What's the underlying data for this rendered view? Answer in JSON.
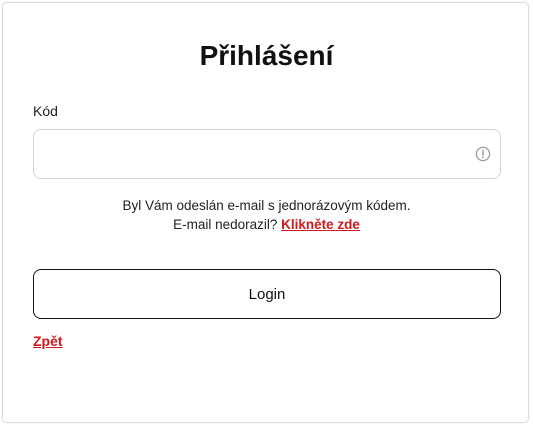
{
  "page": {
    "title": "Přihlášení"
  },
  "form": {
    "code_label": "Kód",
    "code_value": "",
    "code_placeholder": "",
    "info_line1": "Byl Vám odeslán e-mail s jednorázovým kódem.",
    "info_line2_prefix": "E-mail nedorazil?",
    "resend_link": "Klikněte zde",
    "login_button": "Login",
    "back_link": "Zpět"
  },
  "icons": {
    "field_status": "alert-circle-icon"
  },
  "colors": {
    "accent_red": "#d0191f",
    "border": "#d4d4d4",
    "button_border": "#111111",
    "icon_gray": "#9a9a9a"
  }
}
